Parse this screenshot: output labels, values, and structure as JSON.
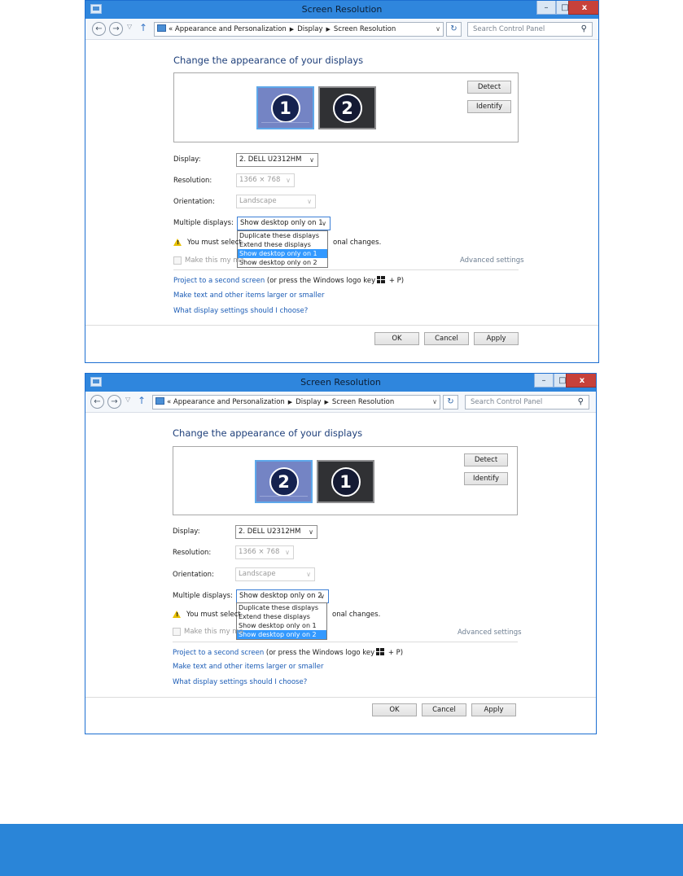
{
  "window_title": "Screen Resolution",
  "controls": {
    "minimize": "–",
    "maximize": "□",
    "close": "x"
  },
  "nav": {
    "back": "←",
    "forward": "→",
    "recent": "▽",
    "up": "↑"
  },
  "breadcrumb": {
    "prefix": "«",
    "items": [
      "Appearance and Personalization",
      "Display",
      "Screen Resolution"
    ]
  },
  "search_placeholder": "Search Control Panel",
  "heading": "Change the appearance of your displays",
  "detect_label": "Detect",
  "identify_label": "Identify",
  "display_label": "Display:",
  "display_value": "2. DELL U2312HM",
  "resolution_label": "Resolution:",
  "resolution_value": "1366 × 768",
  "orientation_label": "Orientation:",
  "orientation_value": "Landscape",
  "multiple_label": "Multiple displays:",
  "multiple_options": [
    "Duplicate these displays",
    "Extend these displays",
    "Show desktop only on 1",
    "Show desktop only on 2"
  ],
  "warning_left": "You must select",
  "warning_right": "onal changes.",
  "make_main_label": "Make this my ma",
  "advanced_settings": "Advanced settings",
  "project_link": "Project to a second screen",
  "project_suffix": " (or press the Windows logo key",
  "project_suffix_end": " + P)",
  "text_size_link": "Make text and other items larger or smaller",
  "which_settings_link": "What display settings should I choose?",
  "ok_label": "OK",
  "cancel_label": "Cancel",
  "apply_label": "Apply",
  "screenshots": [
    {
      "monitors": [
        "1",
        "2"
      ],
      "selected_option": "Show desktop only on 1",
      "highlighted_index": 2
    },
    {
      "monitors": [
        "2",
        "1"
      ],
      "selected_option": "Show desktop only on 2",
      "highlighted_index": 3
    }
  ],
  "colors": {
    "accent": "#2f86dd",
    "link": "#1a5bb5",
    "highlight": "#3399ff",
    "footer": "#2a85d8"
  }
}
